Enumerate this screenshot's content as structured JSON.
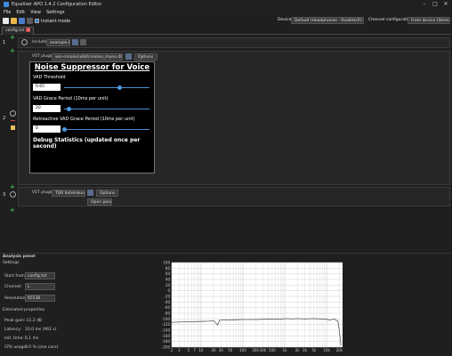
{
  "window": {
    "title": "Equalizer APO 1.4.2 Configuration Editor"
  },
  "menu": [
    "File",
    "Edit",
    "View",
    "Settings"
  ],
  "toolbar": {
    "instant_mode_label": "Instant mode"
  },
  "device": {
    "label": "Device:",
    "value": "Default (Headphones - Realtek(R) Audio)"
  },
  "channel_config": {
    "label": "Channel configuration:",
    "value": "From device (Stereo)"
  },
  "tab": {
    "name": "config.txt"
  },
  "filters": {
    "row1": {
      "index": "1",
      "include_label": "Include:",
      "include_value": "example.txt"
    },
    "row2": {
      "index": "2",
      "vst_label": "VST plugin:",
      "vst_path": "win-rnnoise\\x64\\rnnoise_mono.dll",
      "options_label": "Options",
      "plugin": {
        "title": "Noise Suppressor for Voice",
        "vad_threshold_label": "VAD Threshold",
        "vad_threshold_value": "0.65",
        "vad_threshold_level": 0.65,
        "grace_label": "VAD Grace Period (10ms per unit)",
        "grace_value": "20",
        "grace_level": 0.06,
        "retro_label": "Retroactive VAD Grace Period (10ms per unit)",
        "retro_value": "0",
        "retro_level": 0.0,
        "debug_label": "Debug Statistics (updated once per second)"
      }
    },
    "row3": {
      "index": "3",
      "vst_label": "VST plugin:",
      "vst_path": "TDR Kotelnikov.dll",
      "options_label": "Options",
      "open_panel_label": "Open panel"
    }
  },
  "analysis": {
    "panel_title": "Analysis panel",
    "settings_title": "Settings",
    "start_from_label": "Start from:",
    "start_from_value": "config.txt",
    "channel_label": "Channel:",
    "channel_value": "L",
    "resolution_label": "Resolution:",
    "resolution_value": "65536",
    "estimated_title": "Estimated properties",
    "peak_gain_label": "Peak gain:",
    "peak_gain_value": "-11.2 dB",
    "latency_label": "Latency:",
    "latency_value": "10.0 ms (961 s)",
    "init_time_label": "Init. time:",
    "init_time_value": "6.1 ms",
    "cpu_label": "CPU usage:",
    "cpu_value": "3.0 % (one core)"
  },
  "chart_data": {
    "type": "line",
    "y_ticks": [
      "100",
      "80",
      "60",
      "40",
      "20",
      "0",
      "-20",
      "-40",
      "-60",
      "-80",
      "-100",
      "-120",
      "-140",
      "-160",
      "-180",
      "-200"
    ],
    "x_ticks": [
      "2",
      "3",
      "5",
      "7",
      "10",
      "20",
      "30",
      "50",
      "100",
      "200",
      "300",
      "500",
      "1k",
      "2k",
      "3k",
      "5k",
      "10k",
      "20k"
    ],
    "ylim": [
      -200,
      100
    ],
    "x_log_range": [
      2,
      24000
    ],
    "series": [
      {
        "freq": [
          2,
          5,
          10,
          15,
          20,
          25,
          28,
          32,
          40,
          60,
          100,
          200,
          300,
          500,
          800,
          1000,
          1500,
          2000,
          3000,
          5000,
          7000,
          10000,
          12000,
          15000,
          17000,
          18500,
          20000,
          22000
        ],
        "gain": [
          -112,
          -110,
          -109,
          -108,
          -107,
          -121,
          -105,
          -104,
          -104,
          -103,
          -102,
          -102,
          -101,
          -100,
          -101,
          -99,
          -100,
          -99,
          -100,
          -99,
          -100,
          -101,
          -104,
          -100,
          -105,
          -107,
          -140,
          -195
        ]
      }
    ]
  },
  "colors": {
    "accent": "#4a8fd2",
    "plus": "#3fbf4b"
  }
}
